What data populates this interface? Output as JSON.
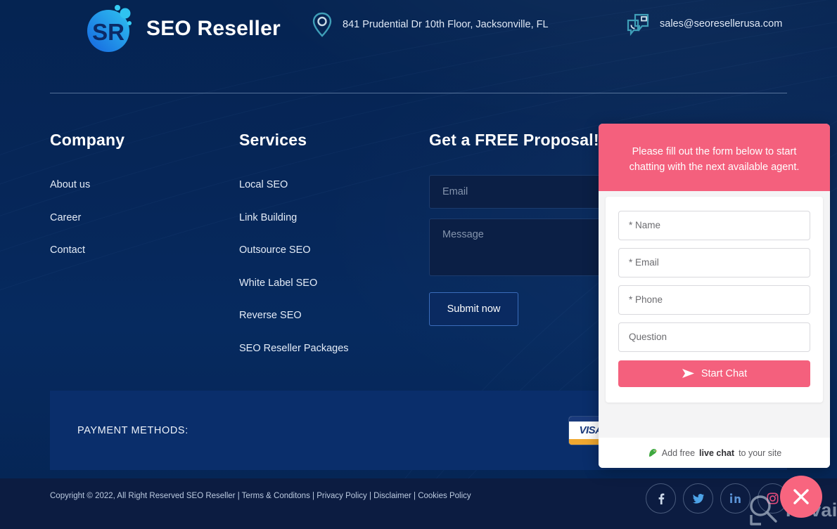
{
  "header": {
    "logo_text": "SEO Reseller",
    "logo_icon": "sr-logo-icon",
    "address_icon": "map-pin-icon",
    "address": "841 Prudential Dr 10th Floor, Jacksonville, FL",
    "email_icon": "chat-mail-icon",
    "email": "sales@seoresellerusa.com"
  },
  "company": {
    "title": "Company",
    "links": [
      {
        "label": "About us"
      },
      {
        "label": "Career"
      },
      {
        "label": "Contact"
      }
    ]
  },
  "services": {
    "title": "Services",
    "links": [
      {
        "label": "Local SEO"
      },
      {
        "label": "Link Building"
      },
      {
        "label": "Outsource SEO"
      },
      {
        "label": "White Label SEO"
      },
      {
        "label": "Reverse SEO"
      },
      {
        "label": "SEO Reseller Packages"
      }
    ]
  },
  "proposal": {
    "title": "Get a FREE Proposal!",
    "email_placeholder": "Email",
    "email_value": "",
    "message_placeholder": "Message",
    "message_value": "",
    "submit_label": "Submit now"
  },
  "payment": {
    "label": "PAYMENT METHODS:",
    "cards": [
      {
        "name": "visa-card-icon",
        "label": "VISA"
      },
      {
        "name": "card-icon-2",
        "label": ""
      }
    ]
  },
  "bottom": {
    "copyright": "Copyright © 2022, All Right Reserved SEO Reseller | Terms & Conditons | Privacy Policy | Disclaimer | Cookies Policy",
    "socials": [
      {
        "name": "facebook-icon",
        "glyph": "f"
      },
      {
        "name": "twitter-icon",
        "glyph": "t"
      },
      {
        "name": "linkedin-icon",
        "glyph": "in"
      },
      {
        "name": "instagram-icon",
        "glyph": "ig"
      }
    ]
  },
  "watermark": {
    "text": "Revain",
    "icon": "revain-logo-icon"
  },
  "chat": {
    "header_text": "Please fill out the form below to start chatting with the next available agent.",
    "fields": [
      {
        "name": "chat-name-input",
        "placeholder": "* Name",
        "value": ""
      },
      {
        "name": "chat-email-input",
        "placeholder": "* Email",
        "value": ""
      },
      {
        "name": "chat-phone-input",
        "placeholder": "* Phone",
        "value": ""
      },
      {
        "name": "chat-question-input",
        "placeholder": "Question",
        "value": ""
      }
    ],
    "start_label": "Start Chat",
    "send_icon": "send-arrow-icon",
    "footer_icon": "parrot-icon",
    "footer_pre": "Add free ",
    "footer_bold": "live chat",
    "footer_post": " to your site",
    "close_icon": "close-x-icon"
  },
  "colors": {
    "background": "#062558",
    "panel": "#0a2e6b",
    "bottom_bar": "#0c1c41",
    "accent_pink": "#f4607d",
    "logo_blue": "#2196f3"
  }
}
